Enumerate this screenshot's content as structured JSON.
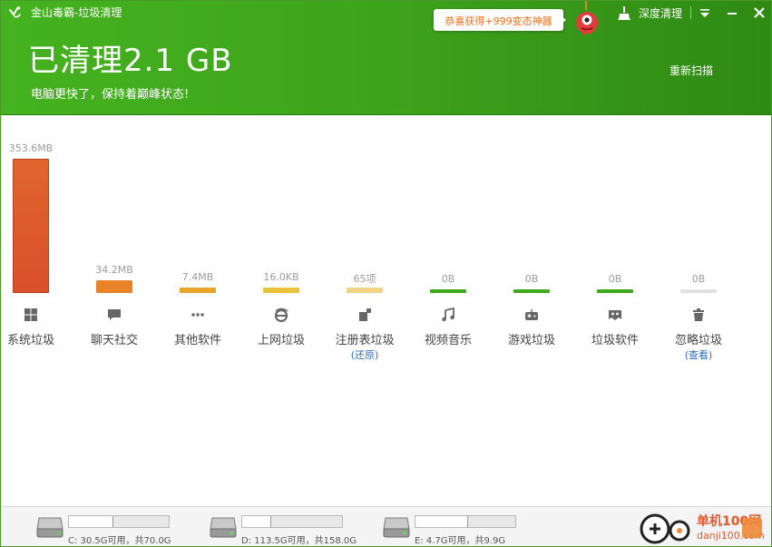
{
  "window": {
    "title": "金山毒霸-垃圾清理",
    "headline": "已清理2.1 GB",
    "subline": "电脑更快了，保持着巅峰状态!",
    "rescan_label": "重新扫描",
    "promo_label": "恭喜获得+999变态神器",
    "deep_clean_label": "深度清理",
    "accent_color": "#3fa81d"
  },
  "categories": [
    {
      "label": "系统垃圾",
      "value": "353.6MB",
      "icon": "windows-icon",
      "bar_color": "#d94f2b"
    },
    {
      "label": "聊天社交",
      "value": "34.2MB",
      "icon": "chat-icon",
      "bar_color": "#e8832a"
    },
    {
      "label": "其他软件",
      "value": "7.4MB",
      "icon": "more-icon",
      "bar_color": "#e8a52a"
    },
    {
      "label": "上网垃圾",
      "value": "16.0KB",
      "icon": "ie-icon",
      "bar_color": "#ebc23a"
    },
    {
      "label": "注册表垃圾",
      "value": "65项",
      "icon": "registry-icon",
      "bar_color": "#f3d486",
      "link": "(还原)"
    },
    {
      "label": "视频音乐",
      "value": "0B",
      "icon": "music-icon",
      "bar_color": "#3fa81d"
    },
    {
      "label": "游戏垃圾",
      "value": "0B",
      "icon": "gamepad-icon",
      "bar_color": "#3fa81d"
    },
    {
      "label": "垃圾软件",
      "value": "0B",
      "icon": "junk-software-icon",
      "bar_color": "#3fa81d"
    },
    {
      "label": "忽略垃圾",
      "value": "0B",
      "icon": "trash-icon",
      "bar_color": "#e2e2e2",
      "link": "(查看)"
    }
  ],
  "drives": [
    {
      "text": "C: 30.5G可用，共70.0G",
      "free_fraction": 0.44
    },
    {
      "text": "D: 113.5G可用，共158.0G",
      "free_fraction": 0.28
    },
    {
      "text": "E: 4.7G可用，共9.9G",
      "free_fraction": 0.52
    }
  ],
  "watermark": {
    "text": "单机100网",
    "url": "danji100.com"
  }
}
